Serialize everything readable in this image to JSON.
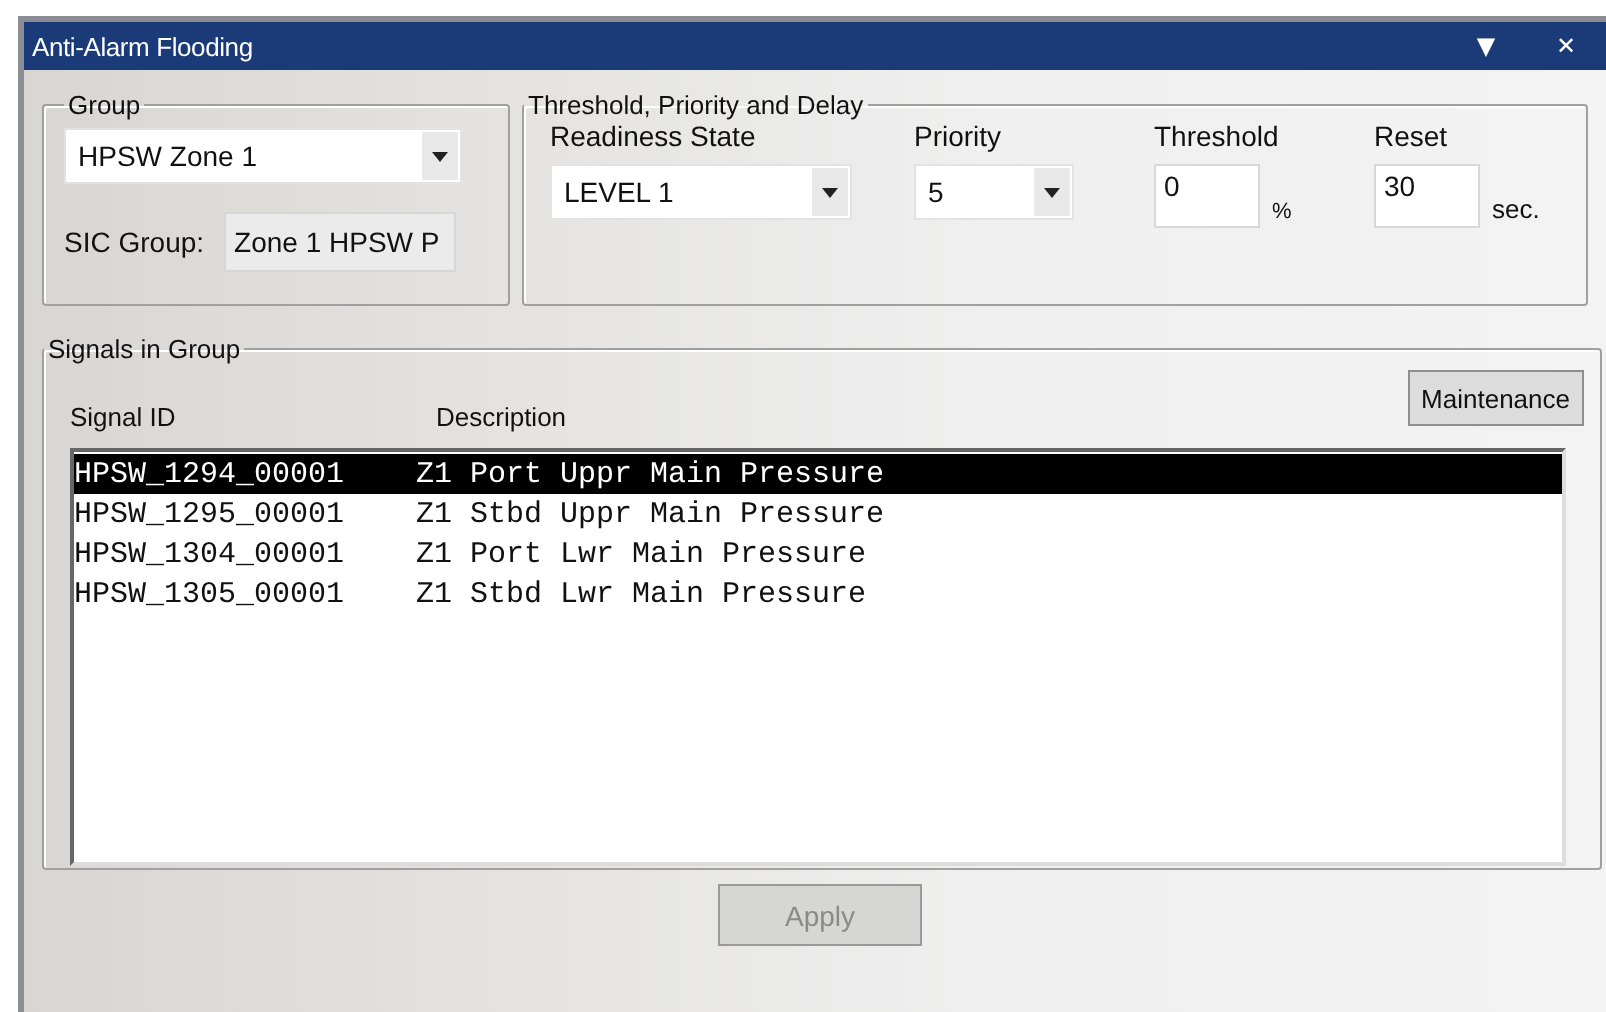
{
  "window": {
    "title": "Anti-Alarm Flooding",
    "menu_glyph": "▼",
    "close_glyph": "✕"
  },
  "group": {
    "legend": "Group",
    "value": "HPSW Zone 1",
    "sic_label": "SIC Group:",
    "sic_value": "Zone 1 HPSW P"
  },
  "threshold": {
    "legend": "Threshold, Priority and Delay",
    "readiness_label": "Readiness State",
    "readiness_value": "LEVEL 1",
    "priority_label": "Priority",
    "priority_value": "5",
    "threshold_label": "Threshold",
    "threshold_value": "0",
    "threshold_unit": "%",
    "reset_label": "Reset",
    "reset_value": "30",
    "reset_unit": "sec."
  },
  "signals": {
    "legend": "Signals in Group",
    "maintenance_button": "Maintenance",
    "columns": [
      "Signal ID",
      "Description"
    ],
    "rows": [
      {
        "id": "HPSW_1294_00001",
        "description": "Z1 Port Uppr Main Pressure",
        "selected": true
      },
      {
        "id": "HPSW_1295_00001",
        "description": "Z1 Stbd Uppr Main Pressure",
        "selected": false
      },
      {
        "id": "HPSW_1304_00001",
        "description": "Z1 Port Lwr Main Pressure",
        "selected": false
      },
      {
        "id": "HPSW_1305_00001",
        "description": "Z1 Stbd Lwr Main Pressure",
        "selected": false
      }
    ]
  },
  "apply_button": {
    "label": "Apply",
    "disabled": true
  }
}
